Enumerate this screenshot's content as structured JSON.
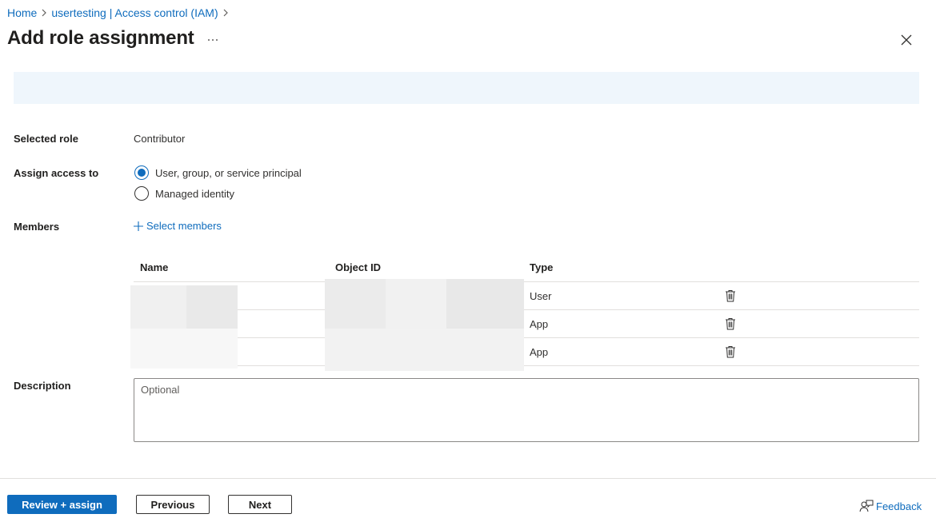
{
  "breadcrumb": {
    "items": [
      "Home",
      "usertesting | Access control (IAM)"
    ]
  },
  "header": {
    "title": "Add role assignment",
    "more_label": "···"
  },
  "form": {
    "selected_role_label": "Selected role",
    "selected_role_value": "Contributor",
    "assign_access_label": "Assign access to",
    "assign_options": [
      {
        "label": "User, group, or service principal",
        "checked": true
      },
      {
        "label": "Managed identity",
        "checked": false
      }
    ],
    "members_label": "Members",
    "select_members_label": "Select members",
    "description_label": "Description",
    "description_placeholder": "Optional"
  },
  "members_table": {
    "columns": [
      "Name",
      "Object ID",
      "Type"
    ],
    "rows": [
      {
        "type": "User"
      },
      {
        "type": "App"
      },
      {
        "type": "App"
      }
    ]
  },
  "footer": {
    "review_assign_label": "Review + assign",
    "previous_label": "Previous",
    "next_label": "Next",
    "feedback_label": "Feedback"
  },
  "colors": {
    "accent": "#0f6cbd",
    "banner": "#eff6fc"
  }
}
